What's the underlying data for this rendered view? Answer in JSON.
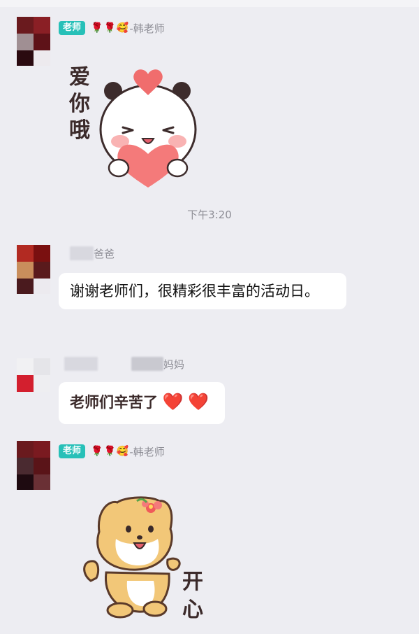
{
  "messages": [
    {
      "sender_badge": "老师",
      "sender_emojis": [
        "🌹",
        "🌹",
        "🥰"
      ],
      "sender_name": "-韩老师",
      "sticker": {
        "name": "panda-heart",
        "text_chars": [
          "爱",
          "你",
          "哦"
        ]
      }
    },
    {
      "timestamp": "下午3:20"
    },
    {
      "sender_name": "爸爸",
      "text": "谢谢老师们，很精彩很丰富的活动日。"
    },
    {
      "sender_name": "妈妈",
      "text": "老师们辛苦了",
      "hearts": [
        "❤️",
        "❤️"
      ]
    },
    {
      "sender_badge": "老师",
      "sender_emojis": [
        "🌹",
        "🌹",
        "🥰"
      ],
      "sender_name": "-韩老师",
      "sticker": {
        "name": "shiba-happy",
        "text_chars": [
          "开",
          "心"
        ]
      }
    }
  ]
}
